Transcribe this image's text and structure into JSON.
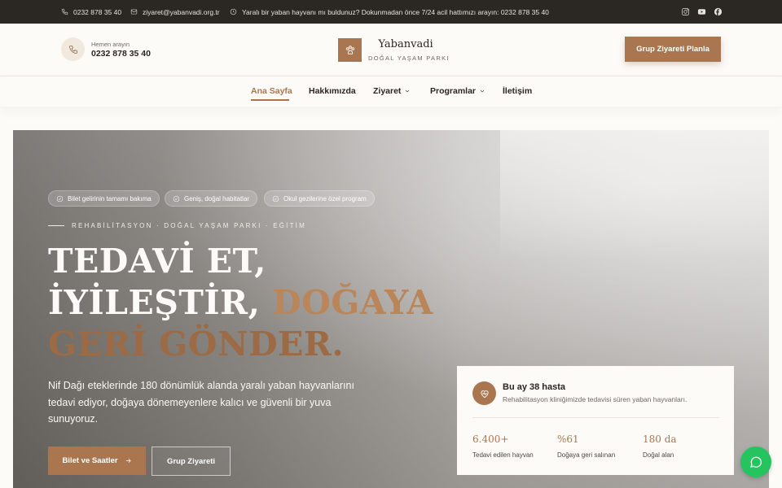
{
  "topbar": {
    "phone": "0232 878 35 40",
    "email": "ziyaret@yabanvadi.org.tr",
    "emergency": "Yaralı bir yaban hayvanı mı buldunuz? Dokunmadan önce 7/24 acil hattımızı arayın: 0232 878 35 40",
    "social": [
      "instagram-icon",
      "youtube-icon",
      "facebook-icon"
    ]
  },
  "header": {
    "call_label": "Hemen arayın",
    "call_number": "0232 878 35 40",
    "logo_name": "Yabanvadi",
    "logo_sub": "DOĞAL YAŞAM PARKI",
    "cta": "Grup Ziyareti Planla"
  },
  "nav": {
    "items": [
      {
        "label": "Ana Sayfa",
        "active": true
      },
      {
        "label": "Hakkımızda"
      },
      {
        "label": "Ziyaret",
        "dropdown": true
      },
      {
        "label": "Programlar",
        "dropdown": true
      },
      {
        "label": "İletişim"
      }
    ]
  },
  "hero": {
    "chips": [
      "Bilet gelirinin tamamı bakıma",
      "Geniş, doğal habitatlar",
      "Okul gezilerine özel program"
    ],
    "eyebrow": "REHABİLİTASYON · DOĞAL YAŞAM PARKI · EĞİTİM",
    "title_line1": "TEDAVİ ET,",
    "title_line2a": "İYİLEŞTİR, ",
    "title_line2b": "DOĞAYA",
    "title_line3": "GERİ GÖNDER.",
    "lead": "Nif Dağı eteklerinde 180 dönümlük alanda yaralı yaban hayvanlarını tedavi ediyor, doğaya dönemeyenlere kalıcı ve güvenli bir yuva sunuyoruz.",
    "btn_primary": "Bilet ve Saatler",
    "btn_secondary": "Grup Ziyareti"
  },
  "stats": {
    "title": "Bu ay 38 hasta",
    "subtitle": "Rehabilitasyon kliniğimizde tedavisi süren yaban hayvanları.",
    "items": [
      {
        "value": "6.400+",
        "label": "Tedavi edilen hayvan"
      },
      {
        "value": "%61",
        "label": "Doğaya geri salınan"
      },
      {
        "value": "180 da",
        "label": "Doğal alan"
      }
    ]
  },
  "colors": {
    "accent": "#a9764f",
    "topbar": "#2b2723",
    "whatsapp": "#25c45f"
  }
}
